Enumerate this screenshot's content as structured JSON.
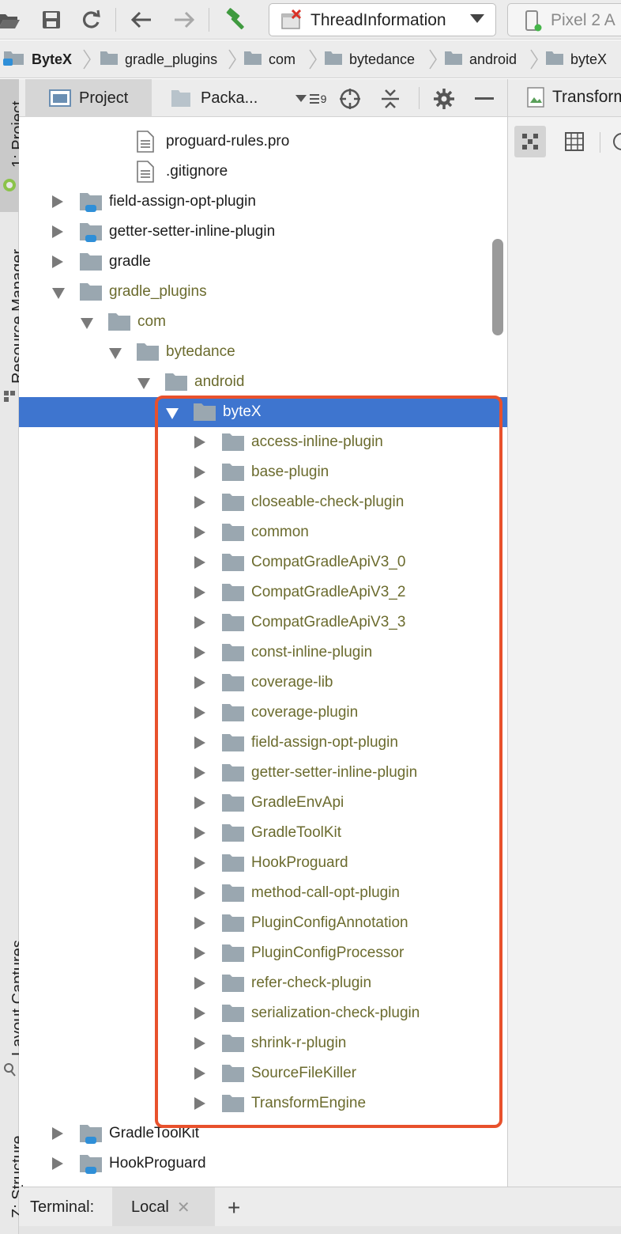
{
  "toolbar": {
    "run_config_label": "ThreadInformation",
    "device_label": "Pixel 2 A",
    "icons": [
      "open-folder-icon",
      "save-icon",
      "sync-icon",
      "back-arrow-icon",
      "forward-arrow-icon",
      "build-hammer-icon",
      "dropdown-icon",
      "device-icon"
    ]
  },
  "breadcrumb": [
    "ByteX",
    "gradle_plugins",
    "com",
    "bytedance",
    "android",
    "byteX"
  ],
  "left_strip": {
    "project_label": "1: Project",
    "resource_manager_label": "Resource Manager",
    "layout_captures_label": "Layout Captures",
    "structure_label": "Z: Structure"
  },
  "panel_header": {
    "project_tab": "Project",
    "packages_tab": "Packa...",
    "filter_badge": "9"
  },
  "right_panel": {
    "tab_label": "Transform"
  },
  "tree": [
    {
      "label": "proguard-rules.pro",
      "kind": "file",
      "style": "plain"
    },
    {
      "label": ".gitignore",
      "kind": "file",
      "style": "plain"
    },
    {
      "label": "field-assign-opt-plugin",
      "kind": "module",
      "expanded": false,
      "style": "plain"
    },
    {
      "label": "getter-setter-inline-plugin",
      "kind": "module",
      "expanded": false,
      "style": "plain"
    },
    {
      "label": "gradle",
      "kind": "folder",
      "expanded": false,
      "style": "plain"
    },
    {
      "label": "gradle_plugins",
      "kind": "folder",
      "expanded": true,
      "style": "olive"
    },
    {
      "label": "com",
      "kind": "folder",
      "expanded": true,
      "style": "olive"
    },
    {
      "label": "bytedance",
      "kind": "folder",
      "expanded": true,
      "style": "olive"
    },
    {
      "label": "android",
      "kind": "folder",
      "expanded": true,
      "style": "olive"
    },
    {
      "label": "byteX",
      "kind": "folder",
      "expanded": true,
      "style": "olive",
      "selected": true
    },
    {
      "label": "access-inline-plugin",
      "kind": "folder",
      "expanded": false,
      "style": "olive"
    },
    {
      "label": "base-plugin",
      "kind": "folder",
      "expanded": false,
      "style": "olive"
    },
    {
      "label": "closeable-check-plugin",
      "kind": "folder",
      "expanded": false,
      "style": "olive"
    },
    {
      "label": "common",
      "kind": "folder",
      "expanded": false,
      "style": "olive"
    },
    {
      "label": "CompatGradleApiV3_0",
      "kind": "folder",
      "expanded": false,
      "style": "olive"
    },
    {
      "label": "CompatGradleApiV3_2",
      "kind": "folder",
      "expanded": false,
      "style": "olive"
    },
    {
      "label": "CompatGradleApiV3_3",
      "kind": "folder",
      "expanded": false,
      "style": "olive"
    },
    {
      "label": "const-inline-plugin",
      "kind": "folder",
      "expanded": false,
      "style": "olive"
    },
    {
      "label": "coverage-lib",
      "kind": "folder",
      "expanded": false,
      "style": "olive"
    },
    {
      "label": "coverage-plugin",
      "kind": "folder",
      "expanded": false,
      "style": "olive"
    },
    {
      "label": "field-assign-opt-plugin",
      "kind": "folder",
      "expanded": false,
      "style": "olive"
    },
    {
      "label": "getter-setter-inline-plugin",
      "kind": "folder",
      "expanded": false,
      "style": "olive"
    },
    {
      "label": "GradleEnvApi",
      "kind": "folder",
      "expanded": false,
      "style": "olive"
    },
    {
      "label": "GradleToolKit",
      "kind": "folder",
      "expanded": false,
      "style": "olive"
    },
    {
      "label": "HookProguard",
      "kind": "folder",
      "expanded": false,
      "style": "olive"
    },
    {
      "label": "method-call-opt-plugin",
      "kind": "folder",
      "expanded": false,
      "style": "olive"
    },
    {
      "label": "PluginConfigAnnotation",
      "kind": "folder",
      "expanded": false,
      "style": "olive"
    },
    {
      "label": "PluginConfigProcessor",
      "kind": "folder",
      "expanded": false,
      "style": "olive"
    },
    {
      "label": "refer-check-plugin",
      "kind": "folder",
      "expanded": false,
      "style": "olive"
    },
    {
      "label": "serialization-check-plugin",
      "kind": "folder",
      "expanded": false,
      "style": "olive"
    },
    {
      "label": "shrink-r-plugin",
      "kind": "folder",
      "expanded": false,
      "style": "olive"
    },
    {
      "label": "SourceFileKiller",
      "kind": "folder",
      "expanded": false,
      "style": "olive"
    },
    {
      "label": "TransformEngine",
      "kind": "folder",
      "expanded": false,
      "style": "olive"
    },
    {
      "label": "GradleToolKit",
      "kind": "module",
      "expanded": false,
      "style": "plain"
    },
    {
      "label": "HookProguard",
      "kind": "module",
      "expanded": false,
      "style": "plain"
    }
  ],
  "bottom_bar": {
    "terminal_label": "Terminal:",
    "local_tab": "Local",
    "close_glyph": "✕",
    "add_glyph": "+"
  },
  "colors": {
    "selection": "#3e75cf",
    "highlight_box": "#e8512c",
    "folder": "#9aa7b0",
    "olive_text": "#6b6b2e"
  }
}
